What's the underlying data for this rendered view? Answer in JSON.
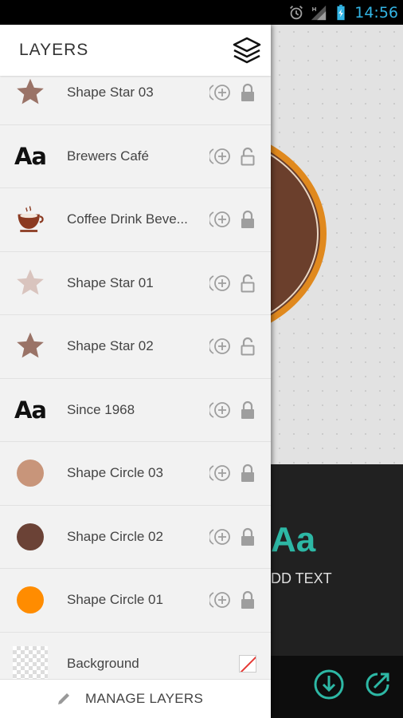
{
  "status_bar": {
    "time": "14:56"
  },
  "background": {
    "text_preview": "Aa",
    "add_text_label": "DD TEXT"
  },
  "drawer": {
    "title": "LAYERS",
    "layers": [
      {
        "name": "Shape Star 03",
        "thumb": "star",
        "color": "#9a7367",
        "locked": true
      },
      {
        "name": "Brewers Café",
        "thumb": "text",
        "color": "#111111",
        "locked": false
      },
      {
        "name": "Coffee Drink Beve...",
        "thumb": "coffee-cup",
        "color": "#8b3a21",
        "locked": true
      },
      {
        "name": "Shape Star 01",
        "thumb": "star",
        "color": "#d9c4be",
        "locked": false
      },
      {
        "name": "Shape Star 02",
        "thumb": "star",
        "color": "#9a7367",
        "locked": false
      },
      {
        "name": "Since 1968",
        "thumb": "text",
        "color": "#111111",
        "locked": true
      },
      {
        "name": "Shape Circle 03",
        "thumb": "circle",
        "color": "#c8957a",
        "locked": true
      },
      {
        "name": "Shape Circle 02",
        "thumb": "circle",
        "color": "#6b4236",
        "locked": true
      },
      {
        "name": "Shape Circle 01",
        "thumb": "circle",
        "color": "#ff8c00",
        "locked": true
      }
    ],
    "background_layer": {
      "name": "Background",
      "thumb": "transparent"
    },
    "text_thumb": "Aa",
    "footer_label": "MANAGE LAYERS"
  },
  "colors": {
    "accent": "#2db8a5",
    "status_time": "#33b5e5",
    "logo_ring": "#e0891e",
    "logo_fill": "#6b3f2c"
  }
}
